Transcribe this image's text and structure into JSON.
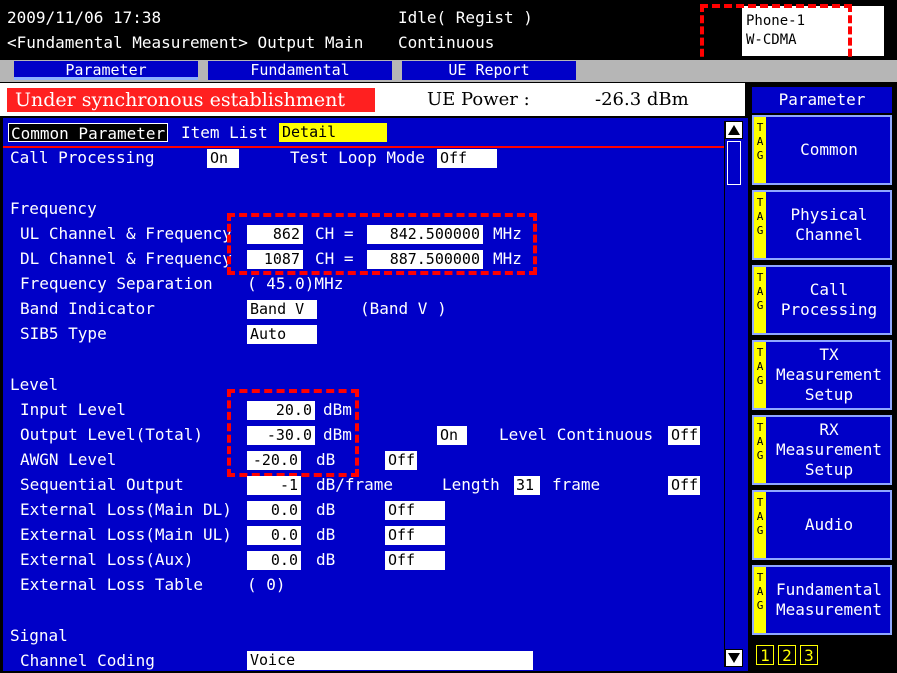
{
  "header": {
    "datetime": "2009/11/06 17:38",
    "screen_title": "<Fundamental Measurement> Output Main",
    "call_state": "Idle( Regist )",
    "mode": "Continuous",
    "phone": "Phone-1",
    "system": "W-CDMA"
  },
  "tabs": [
    "Parameter",
    "Fundamental",
    "UE Report"
  ],
  "status": {
    "sync_message": "Under synchronous establishment",
    "ue_power_label": "UE Power :",
    "ue_power_value": "-26.3 dBm"
  },
  "subtabs": {
    "common": "Common Parameter",
    "item_list": "Item List",
    "detail": "Detail"
  },
  "call": {
    "call_processing_label": "Call Processing",
    "call_processing_value": "On",
    "test_loop_label": "Test Loop Mode",
    "test_loop_value": "Off"
  },
  "frequency": {
    "section": "Frequency",
    "ul_label": "UL Channel & Frequency",
    "ul_ch": "862",
    "ul_freq": "842.500000",
    "dl_label": "DL Channel & Frequency",
    "dl_ch": "1087",
    "dl_freq": "887.500000",
    "ch_eq": "CH =",
    "mhz": "MHz",
    "sep_label": "Frequency Separation",
    "sep_value": "( 45.0)MHz",
    "band_label": "Band Indicator",
    "band_value": "Band V",
    "band_paren": "(Band V    )",
    "sib5_label": "SIB5 Type",
    "sib5_value": "Auto"
  },
  "level": {
    "section": "Level",
    "input_label": "Input Level",
    "input_value": "20.0",
    "output_label": "Output Level(Total)",
    "output_value": "-30.0",
    "output_on": "On",
    "level_cont_label": "Level Continuous",
    "level_cont_value": "Off",
    "awgn_label": "AWGN Level",
    "awgn_value": "-20.0",
    "awgn_off": "Off",
    "seq_label": "Sequential Output",
    "seq_value": "-1",
    "seq_unit": "dB/frame",
    "length_label": "Length",
    "length_value": "31",
    "frame_unit": "frame",
    "seq_off": "Off",
    "ext_dl_label": "External Loss(Main DL)",
    "ext_dl_value": "0.0",
    "ext_dl_off": "Off",
    "ext_ul_label": "External Loss(Main UL)",
    "ext_ul_value": "0.0",
    "ext_ul_off": "Off",
    "ext_aux_label": "External Loss(Aux)",
    "ext_aux_value": "0.0",
    "ext_aux_off": "Off",
    "ext_table_label": "External Loss Table",
    "ext_table_value": "(  0)",
    "dbm": "dBm",
    "db": "dB"
  },
  "signal": {
    "section": "Signal",
    "coding_label": "Channel Coding",
    "coding_value": "Voice"
  },
  "sidebar": {
    "header": "Parameter",
    "tag": "TAG",
    "keys": [
      "Common",
      "Physical\nChannel",
      "Call\nProcessing",
      "TX\nMeasurement\nSetup",
      "RX\nMeasurement\nSetup",
      "Audio",
      "Fundamental\nMeasurement"
    ],
    "pages": [
      "1",
      "2",
      "3"
    ]
  },
  "colors": {
    "panel_blue": "#0000c8",
    "highlight_yellow": "#ffff00",
    "alert_red": "#ff2020",
    "annotation_red": "#ff0000"
  }
}
